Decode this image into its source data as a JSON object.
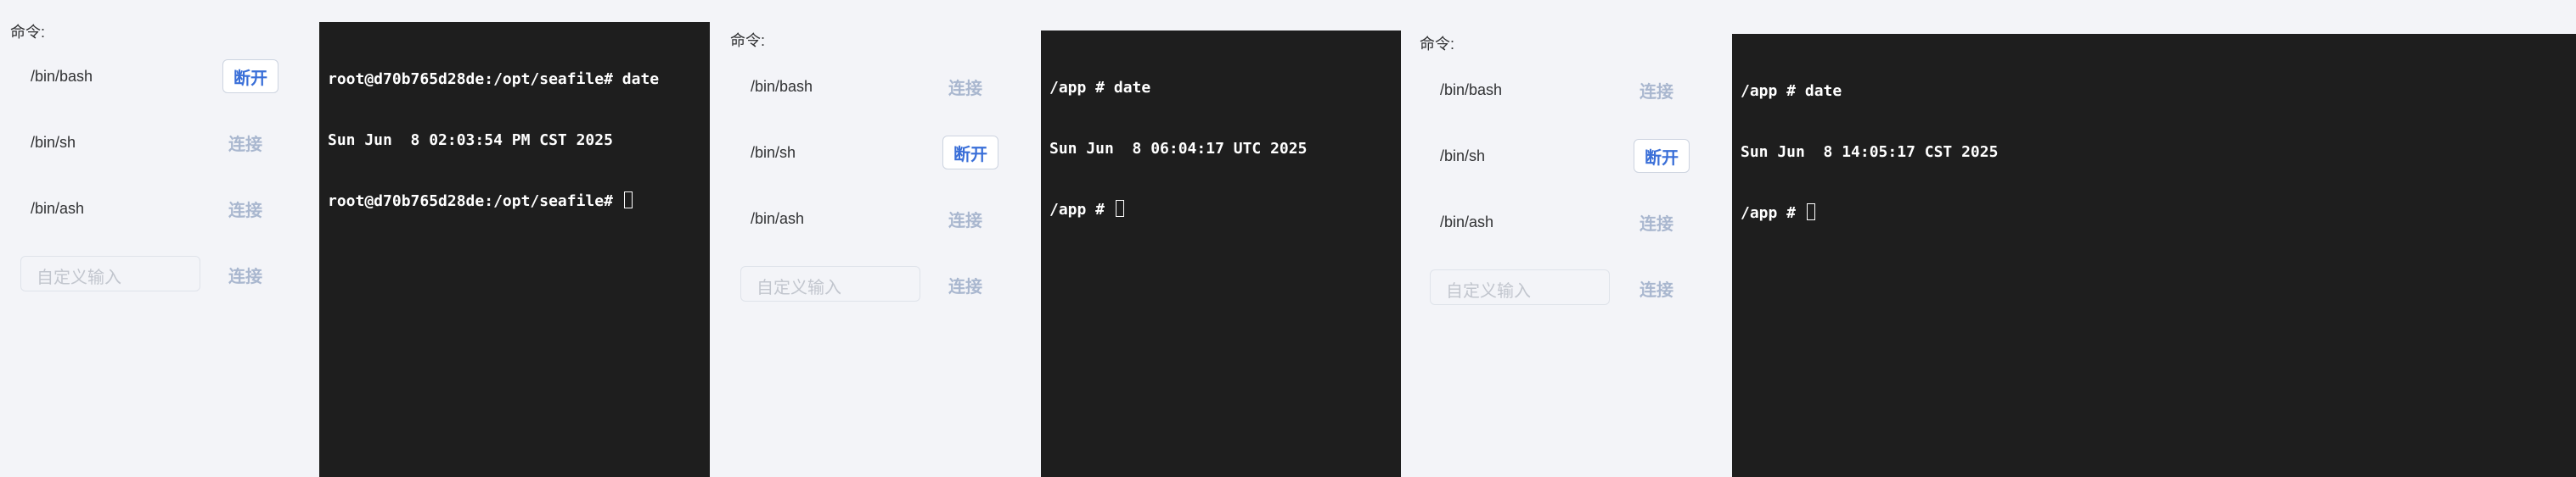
{
  "panels": [
    {
      "command_label": "命令:",
      "shells": [
        {
          "name": "/bin/bash",
          "action": "断开",
          "state": "connected"
        },
        {
          "name": "/bin/sh",
          "action": "连接",
          "state": "idle"
        },
        {
          "name": "/bin/ash",
          "action": "连接",
          "state": "idle"
        }
      ],
      "custom_placeholder": "自定义输入",
      "custom_action": "连接",
      "terminal": {
        "lines": [
          "root@d70b765d28de:/opt/seafile# date",
          "Sun Jun  8 02:03:54 PM CST 2025"
        ],
        "prompt": "root@d70b765d28de:/opt/seafile# "
      }
    },
    {
      "command_label": "命令:",
      "shells": [
        {
          "name": "/bin/bash",
          "action": "连接",
          "state": "idle"
        },
        {
          "name": "/bin/sh",
          "action": "断开",
          "state": "connected"
        },
        {
          "name": "/bin/ash",
          "action": "连接",
          "state": "idle"
        }
      ],
      "custom_placeholder": "自定义输入",
      "custom_action": "连接",
      "terminal": {
        "lines": [
          "/app # date",
          "Sun Jun  8 06:04:17 UTC 2025"
        ],
        "prompt": "/app # "
      }
    },
    {
      "command_label": "命令:",
      "shells": [
        {
          "name": "/bin/bash",
          "action": "连接",
          "state": "idle"
        },
        {
          "name": "/bin/sh",
          "action": "断开",
          "state": "connected"
        },
        {
          "name": "/bin/ash",
          "action": "连接",
          "state": "idle"
        }
      ],
      "custom_placeholder": "自定义输入",
      "custom_action": "连接",
      "terminal": {
        "lines": [
          "/app # date",
          "Sun Jun  8 14:05:17 CST 2025"
        ],
        "prompt": "/app # "
      }
    }
  ]
}
